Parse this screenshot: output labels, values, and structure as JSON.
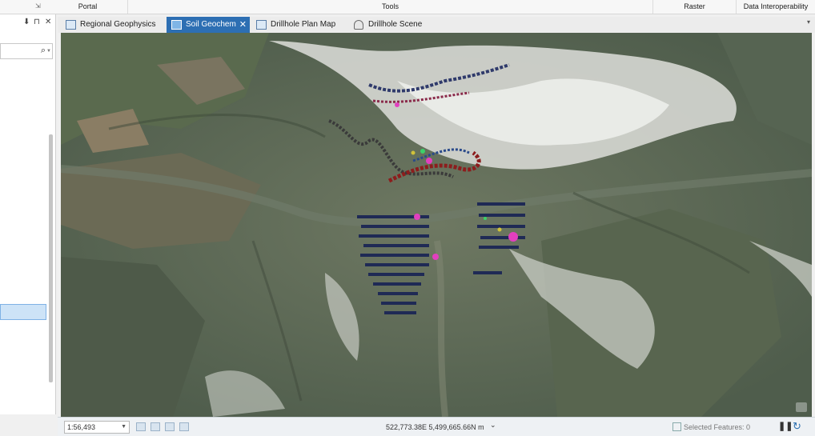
{
  "ribbon": {
    "groups": [
      "Portal",
      "Tools",
      "Raster",
      "Data Interoperability"
    ],
    "launcher": "⇲"
  },
  "left_pane": {
    "pin": "⬇",
    "auto_hide": "⊓",
    "close": "✕"
  },
  "tabs": [
    {
      "label": "Regional Geophysics",
      "active": false
    },
    {
      "label": "Soil Geochem",
      "active": true,
      "close": "✕"
    },
    {
      "label": "Drillhole Plan Map",
      "active": false
    },
    {
      "label": "Drillhole Scene",
      "active": false
    }
  ],
  "status": {
    "scale": "1:56,493",
    "coordinates": "522,773.38E 5,499,665.66N m",
    "selected_features": "Selected Features: 0"
  },
  "colors": {
    "active_tab": "#2d6fb3",
    "selection": "#cde3f7"
  }
}
